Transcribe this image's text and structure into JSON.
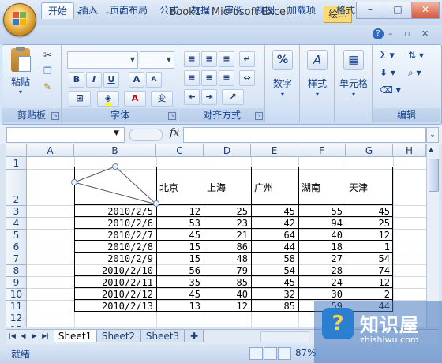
{
  "window": {
    "title": "Book1 - Microsoft Excel",
    "taskbar_tab": "绘...",
    "minimize": "–",
    "restore": "□",
    "close": "✕"
  },
  "ribbon": {
    "tabs": [
      "开始",
      "插入",
      "页面布局",
      "公式",
      "数据",
      "审阅",
      "视图",
      "加载项",
      "格式"
    ],
    "active_tab": "开始",
    "help": "?",
    "groups": {
      "clipboard": {
        "label": "剪贴板",
        "paste": "粘贴"
      },
      "font": {
        "label": "字体",
        "bold": "B",
        "italic": "I",
        "underline": "U",
        "grow": "A",
        "shrink": "A",
        "font_color": "A",
        "phonetic": "变"
      },
      "alignment": {
        "label": "对齐方式"
      },
      "number": {
        "label": "数字",
        "percent": "%"
      },
      "styles": {
        "label": "样式"
      },
      "cells": {
        "label": "单元格"
      },
      "editing": {
        "label": "编辑"
      }
    }
  },
  "formula_bar": {
    "fx": "fx",
    "name_box": "",
    "formula": ""
  },
  "sheet": {
    "columns": [
      "A",
      "B",
      "C",
      "D",
      "E",
      "F",
      "G",
      "H"
    ],
    "rows": [
      "1",
      "2",
      "3",
      "4",
      "5",
      "6",
      "7",
      "8",
      "9",
      "10",
      "11",
      "12",
      "13"
    ],
    "header_cities": [
      "北京",
      "上海",
      "广州",
      "湖南",
      "天津"
    ],
    "data": [
      {
        "date": "2010/2/5",
        "values": [
          "12",
          "25",
          "45",
          "55",
          "45"
        ]
      },
      {
        "date": "2010/2/6",
        "values": [
          "53",
          "23",
          "42",
          "94",
          "25"
        ]
      },
      {
        "date": "2010/2/7",
        "values": [
          "45",
          "21",
          "64",
          "40",
          "12"
        ]
      },
      {
        "date": "2010/2/8",
        "values": [
          "15",
          "86",
          "44",
          "18",
          "1"
        ]
      },
      {
        "date": "2010/2/9",
        "values": [
          "15",
          "48",
          "58",
          "27",
          "54"
        ]
      },
      {
        "date": "2010/2/10",
        "values": [
          "56",
          "79",
          "54",
          "28",
          "74"
        ]
      },
      {
        "date": "2010/2/11",
        "values": [
          "35",
          "85",
          "45",
          "24",
          "12"
        ]
      },
      {
        "date": "2010/2/12",
        "values": [
          "45",
          "40",
          "32",
          "30",
          "2"
        ]
      },
      {
        "date": "2010/2/13",
        "values": [
          "13",
          "12",
          "85",
          "59",
          "44"
        ]
      }
    ]
  },
  "sheet_tabs": [
    "Sheet1",
    "Sheet2",
    "Sheet3"
  ],
  "active_sheet": "Sheet1",
  "status": {
    "ready": "就绪",
    "zoom": "87%"
  },
  "watermark": {
    "title": "知识屋",
    "url": "zhishiwu.com",
    "badge": "?"
  },
  "colors": {
    "ribbon_bg": "#dbe5f1",
    "accent": "#15428b",
    "selected_tab": "#ffffff"
  }
}
